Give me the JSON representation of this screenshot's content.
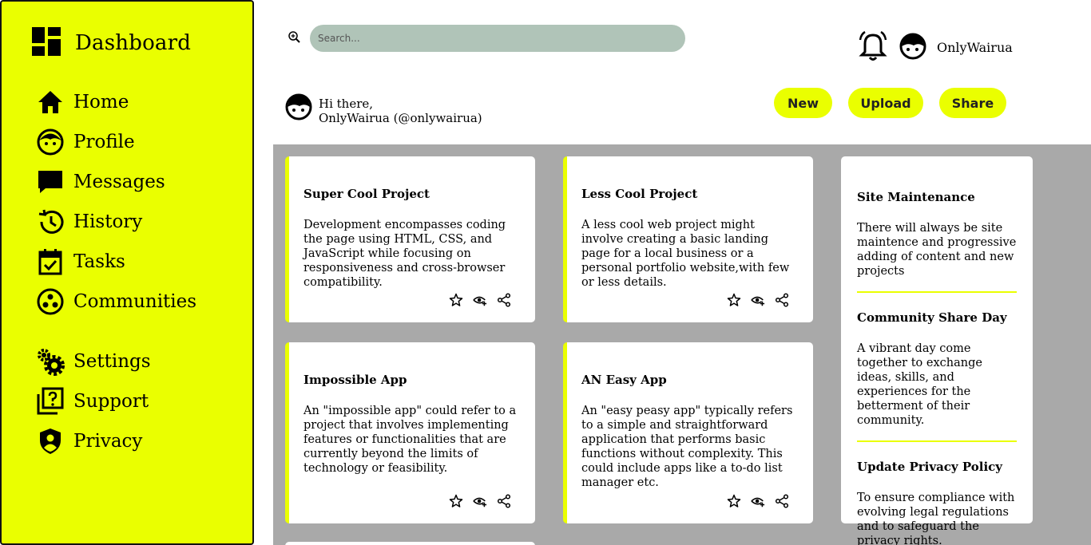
{
  "sidebar": {
    "brand": "Dashboard",
    "items": [
      {
        "label": "Home"
      },
      {
        "label": "Profile"
      },
      {
        "label": "Messages"
      },
      {
        "label": "History"
      },
      {
        "label": "Tasks"
      },
      {
        "label": "Communities"
      },
      {
        "label": "Settings"
      },
      {
        "label": "Support"
      },
      {
        "label": "Privacy"
      }
    ]
  },
  "search": {
    "placeholder": "Search..."
  },
  "header": {
    "username": "OnlyWairua"
  },
  "greeting": {
    "line1": "Hi there,",
    "line2": "OnlyWairua (@onlywairua)"
  },
  "actions": {
    "new": "New",
    "upload": "Upload",
    "share": "Share"
  },
  "cards": [
    {
      "title": "Super Cool Project",
      "body": "Development encompasses coding the page using HTML, CSS, and JavaScript while focusing on responsiveness and cross-browser compatibility."
    },
    {
      "title": "Less Cool Project",
      "body": "A less cool web project might involve creating a basic landing page for a local business or a personal portfolio website,with few or less details."
    },
    {
      "title": "Impossible App",
      "body": "An \"impossible app\" could refer to a project that involves implementing features or functionalities that are currently beyond the limits of technology or feasibility."
    },
    {
      "title": "AN Easy App",
      "body": "An \"easy peasy app\" typically refers to a simple and straightforward application that performs basic functions without complexity. This could include apps like a to-do list manager etc."
    }
  ],
  "announcements": [
    {
      "title": "Site Maintenance",
      "body": "There will always be site maintence and progressive adding of content and new projects"
    },
    {
      "title": "Community Share Day",
      "body": "A vibrant day come together to exchange ideas, skills, and experiences for the betterment of their community."
    },
    {
      "title": "Update Privacy Policy",
      "body": "To ensure compliance with evolving legal regulations and to safeguard the privacy rights."
    }
  ],
  "colors": {
    "accent": "#eaff00",
    "content_bg": "#a9a9a9",
    "search_bg": "#b0c4b8"
  },
  "icons": [
    "dashboard-icon",
    "home-icon",
    "profile-icon",
    "messages-icon",
    "history-icon",
    "tasks-icon",
    "communities-icon",
    "settings-icon",
    "support-icon",
    "privacy-icon",
    "search-icon",
    "bell-icon",
    "avatar",
    "star-icon",
    "watch-icon",
    "share-icon"
  ]
}
